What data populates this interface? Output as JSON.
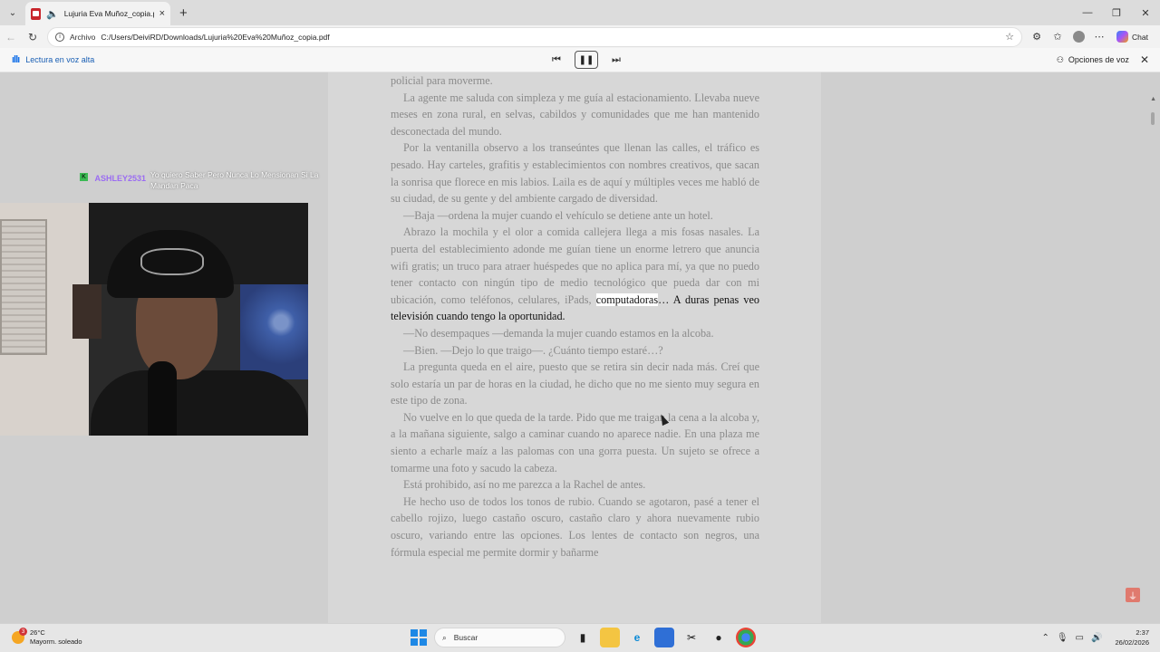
{
  "tabs": [
    {
      "title": "Lujuria Eva Muñoz_copia.pdf",
      "close_icon": "×"
    }
  ],
  "new_tab_label": "+",
  "address_bar": {
    "scheme": "Archivo",
    "url": "C:/Users/DeiviRD/Downloads/Lujuria%20Eva%20Muñoz_copia.pdf"
  },
  "toolbar": {
    "chat_label": "Chat"
  },
  "read_aloud": {
    "label": "Lectura en voz alta",
    "voice_options_label": "Opciones de voz"
  },
  "document": {
    "paragraphs": [
      {
        "text": "policial para moverme.",
        "indent": false
      },
      {
        "text": "La agente me saluda con simpleza y me guía al estacionamiento. Llevaba nueve meses en zona rural, en selvas, cabildos y comunidades que me han mantenido desconectada del mundo.",
        "indent": true
      },
      {
        "text": "Por la ventanilla observo a los transeúntes que llenan las calles, el tráfico es pesado. Hay carteles, grafitis y establecimientos con nombres creativos, que sacan la sonrisa que florece en mis labios. Laila es de aquí y múltiples veces me habló de su ciudad, de su gente y del ambiente cargado de diversidad.",
        "indent": true
      },
      {
        "text": "—Baja —ordena la mujer cuando el vehículo se detiene ante un hotel.",
        "indent": true
      }
    ],
    "highlight_para_before": "Abrazo la mochila y el olor a comida callejera llega a mis fosas nasales. La puerta del establecimiento adonde me guían tiene un enorme letrero que anuncia wifi gratis; un truco para atraer huéspedes que no aplica para mí, ya que no puedo tener contacto con ningún tipo de medio tecnológico que pueda dar con mi ubicación, como teléfonos, celulares, iPads,",
    "highlight_word": "computadoras",
    "highlight_rest": "… A duras penas veo televisión cuando tengo la oportunidad.",
    "paragraphs_after": [
      {
        "text": "—No desempaques —demanda la mujer cuando estamos en la alcoba.",
        "indent": true
      },
      {
        "text": "—Bien. —Dejo lo que traigo—. ¿Cuánto tiempo estaré…?",
        "indent": true
      },
      {
        "text": "La pregunta queda en el aire, puesto que se retira sin decir nada más. Creí que solo estaría un par de horas en la ciudad, he dicho que no me siento muy segura en este tipo de zona.",
        "indent": true
      },
      {
        "text": "No vuelve en lo que queda de la tarde. Pido que me traigan la cena a la alcoba y, a la mañana siguiente, salgo a caminar cuando no aparece nadie. En una plaza me siento a echarle maíz a las palomas con una gorra puesta. Un sujeto se ofrece a tomarme una foto y sacudo la cabeza.",
        "indent": true
      },
      {
        "text": "Está prohibido, así no me parezca a la Rachel de antes.",
        "indent": true
      },
      {
        "text": "He hecho uso de todos los tonos de rubio. Cuando se agotaron, pasé a tener el cabello rojizo, luego castaño oscuro, castaño claro y ahora nuevamente rubio oscuro, variando entre las opciones. Los lentes de contacto son negros, una fórmula especial me permite dormir y bañarme",
        "indent": true
      }
    ]
  },
  "stream_chat": {
    "badge": "K",
    "username": "ASHLEY2531",
    "message": "Yo quiero Saber Pero Nunca Lo Mensionan Si La Mandan Paca"
  },
  "taskbar": {
    "weather_temp": "26°C",
    "weather_desc": "Mayorm. soleado",
    "weather_badge": "3",
    "search_label": "Buscar",
    "time": "2:37",
    "date": "26/02/2026"
  },
  "colors": {
    "accent": "#1a73e8",
    "pdf_red": "#c8262c",
    "page_bg": "#d7d7d7",
    "chat_user": "#9b6cf2"
  }
}
